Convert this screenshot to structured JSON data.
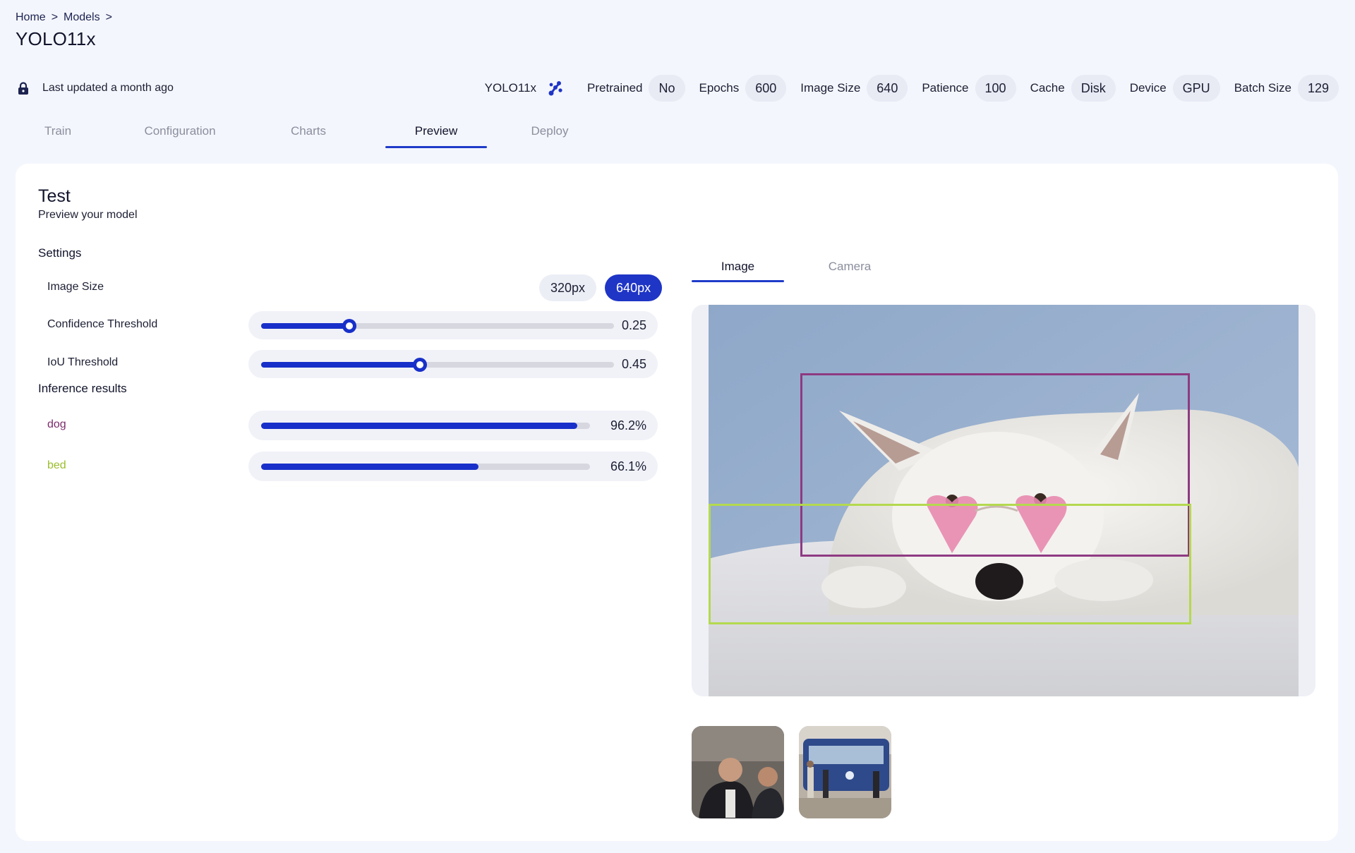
{
  "breadcrumb": {
    "items": [
      "Home",
      "Models"
    ],
    "separator": ">"
  },
  "page_title": "YOLO11x",
  "meta": {
    "lock_icon": "lock-icon",
    "last_updated": "Last updated a month ago",
    "model_name": "YOLO11x",
    "model_icon": "model-nodes-icon",
    "pretrained": {
      "label": "Pretrained",
      "value": "No"
    },
    "epochs": {
      "label": "Epochs",
      "value": "600"
    },
    "image_size": {
      "label": "Image Size",
      "value": "640"
    },
    "patience": {
      "label": "Patience",
      "value": "100"
    },
    "cache": {
      "label": "Cache",
      "value": "Disk"
    },
    "device": {
      "label": "Device",
      "value": "GPU"
    },
    "batch_size": {
      "label": "Batch Size",
      "value": "129"
    }
  },
  "tabs": [
    {
      "label": "Train"
    },
    {
      "label": "Configuration"
    },
    {
      "label": "Charts"
    },
    {
      "label": "Preview",
      "active": true
    },
    {
      "label": "Deploy"
    }
  ],
  "test": {
    "title": "Test",
    "subtitle": "Preview your model",
    "settings_label": "Settings",
    "image_size": {
      "label": "Image Size",
      "options": [
        "320px",
        "640px"
      ],
      "selected": "640px"
    },
    "confidence": {
      "label": "Confidence Threshold",
      "value": "0.25",
      "fraction": 0.25
    },
    "iou": {
      "label": "IoU Threshold",
      "value": "0.45",
      "fraction": 0.45
    },
    "inference_label": "Inference results",
    "results": [
      {
        "label": "dog",
        "value": "96.2%",
        "fraction": 0.962,
        "color": "#7b2b6b"
      },
      {
        "label": "bed",
        "value": "66.1%",
        "fraction": 0.661,
        "color": "#9bbd2c"
      }
    ]
  },
  "preview": {
    "tabs": [
      {
        "label": "Image",
        "active": true
      },
      {
        "label": "Camera"
      }
    ],
    "box_colors": {
      "dog": "#8e3a82",
      "bed": "#b4d94f"
    }
  },
  "colors": {
    "accent": "#1f35c6",
    "background": "#f4f6fd",
    "pill": "#e8eaf4"
  }
}
